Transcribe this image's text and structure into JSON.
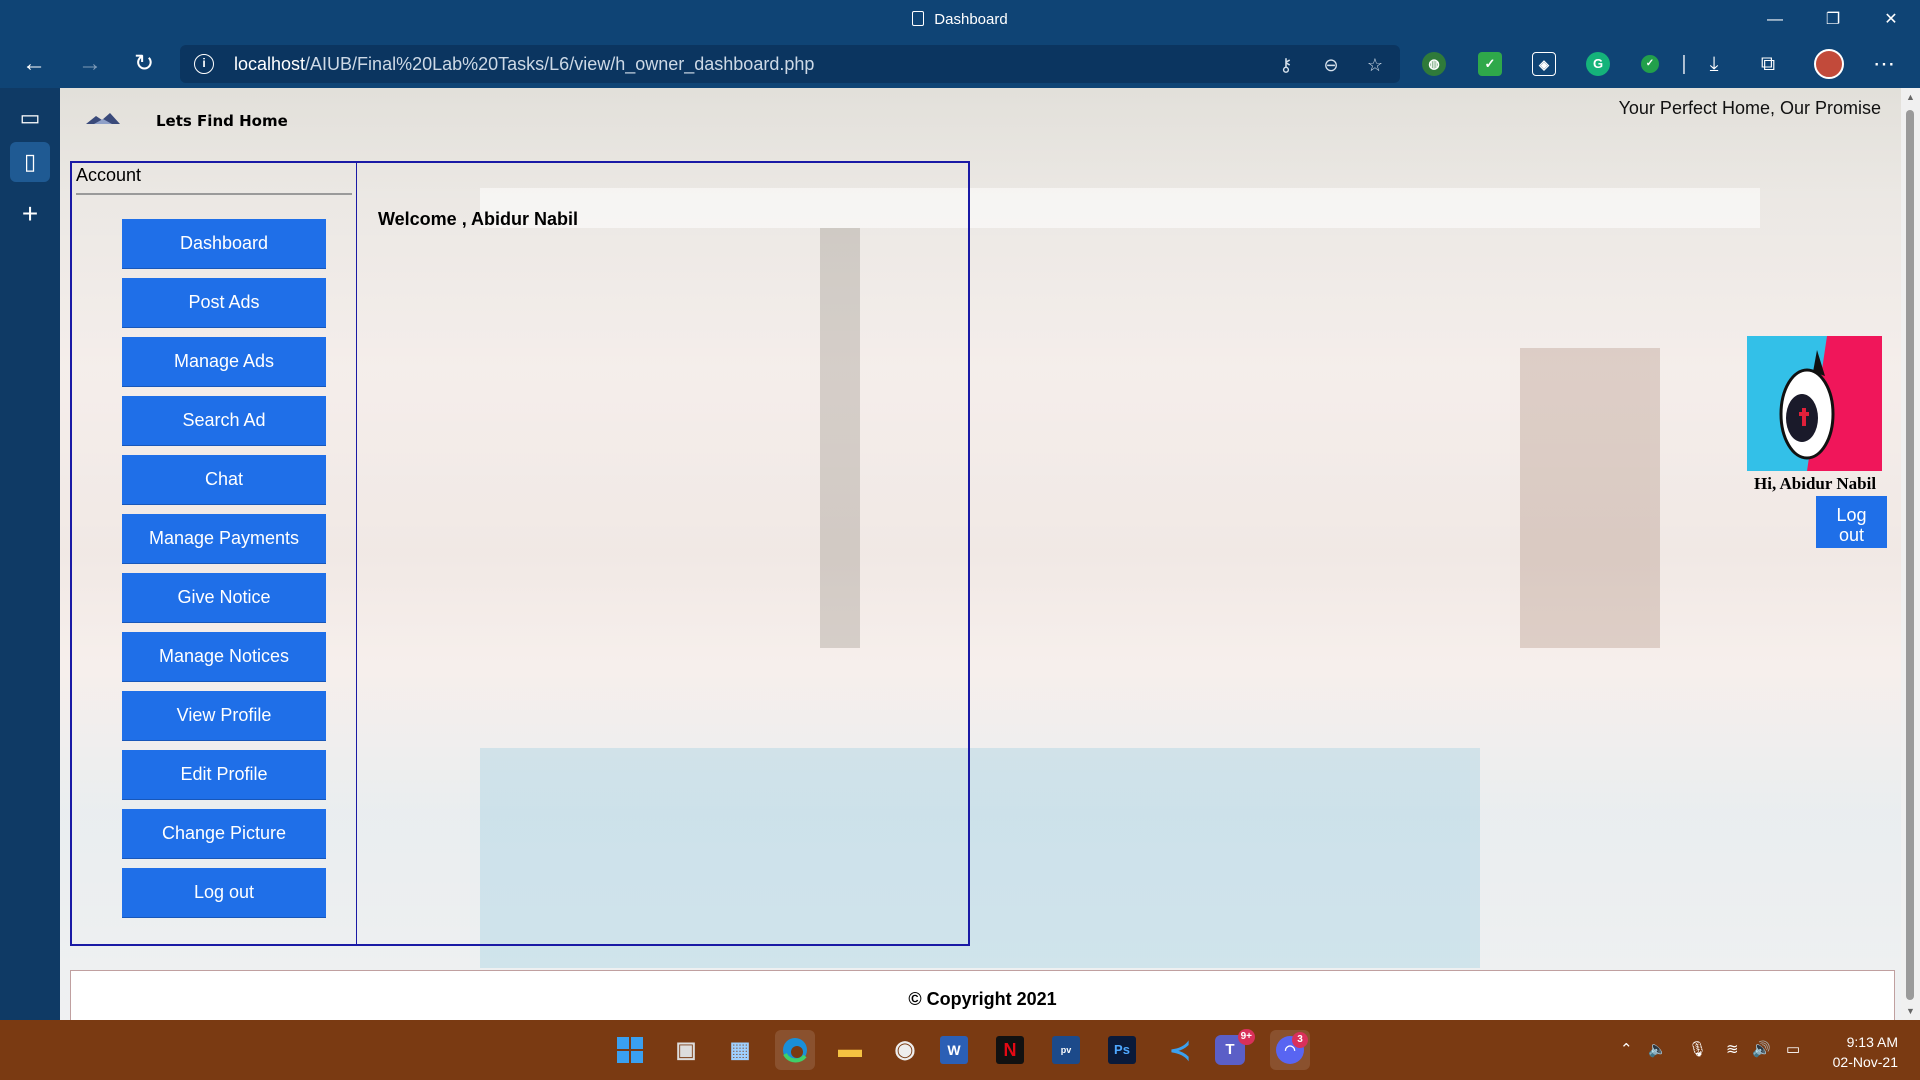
{
  "window": {
    "title": "Dashboard",
    "minimize": "—",
    "restore": "❐",
    "close": "✕"
  },
  "browser": {
    "url_host": "localhost",
    "url_path": "/AIUB/Final%20Lab%20Tasks/L6/view/h_owner_dashboard.php"
  },
  "page": {
    "brand": "Lets Find Home",
    "tagline": "Your Perfect Home, Our Promise",
    "account_label": "Account",
    "welcome": "Welcome , Abidur Nabil",
    "menu": [
      "Dashboard",
      "Post Ads",
      "Manage Ads",
      "Search Ad",
      "Chat",
      "Manage Payments",
      "Give Notice",
      "Manage Notices",
      "View Profile",
      "Edit Profile",
      "Change Picture",
      "Log out"
    ],
    "greeting": "Hi, Abidur Nabil",
    "logout_small_line1": "Log",
    "logout_small_line2": "out",
    "footer": "© Copyright 2021"
  },
  "taskbar": {
    "teams_badge": "9+",
    "discord_badge": "3",
    "time": "9:13 AM",
    "date": "02-Nov-21"
  },
  "colors": {
    "button_blue": "#1f6fe8",
    "box_border": "#1a1aa5",
    "titlebar": "#0f4475",
    "taskbar": "#7a3a12"
  }
}
